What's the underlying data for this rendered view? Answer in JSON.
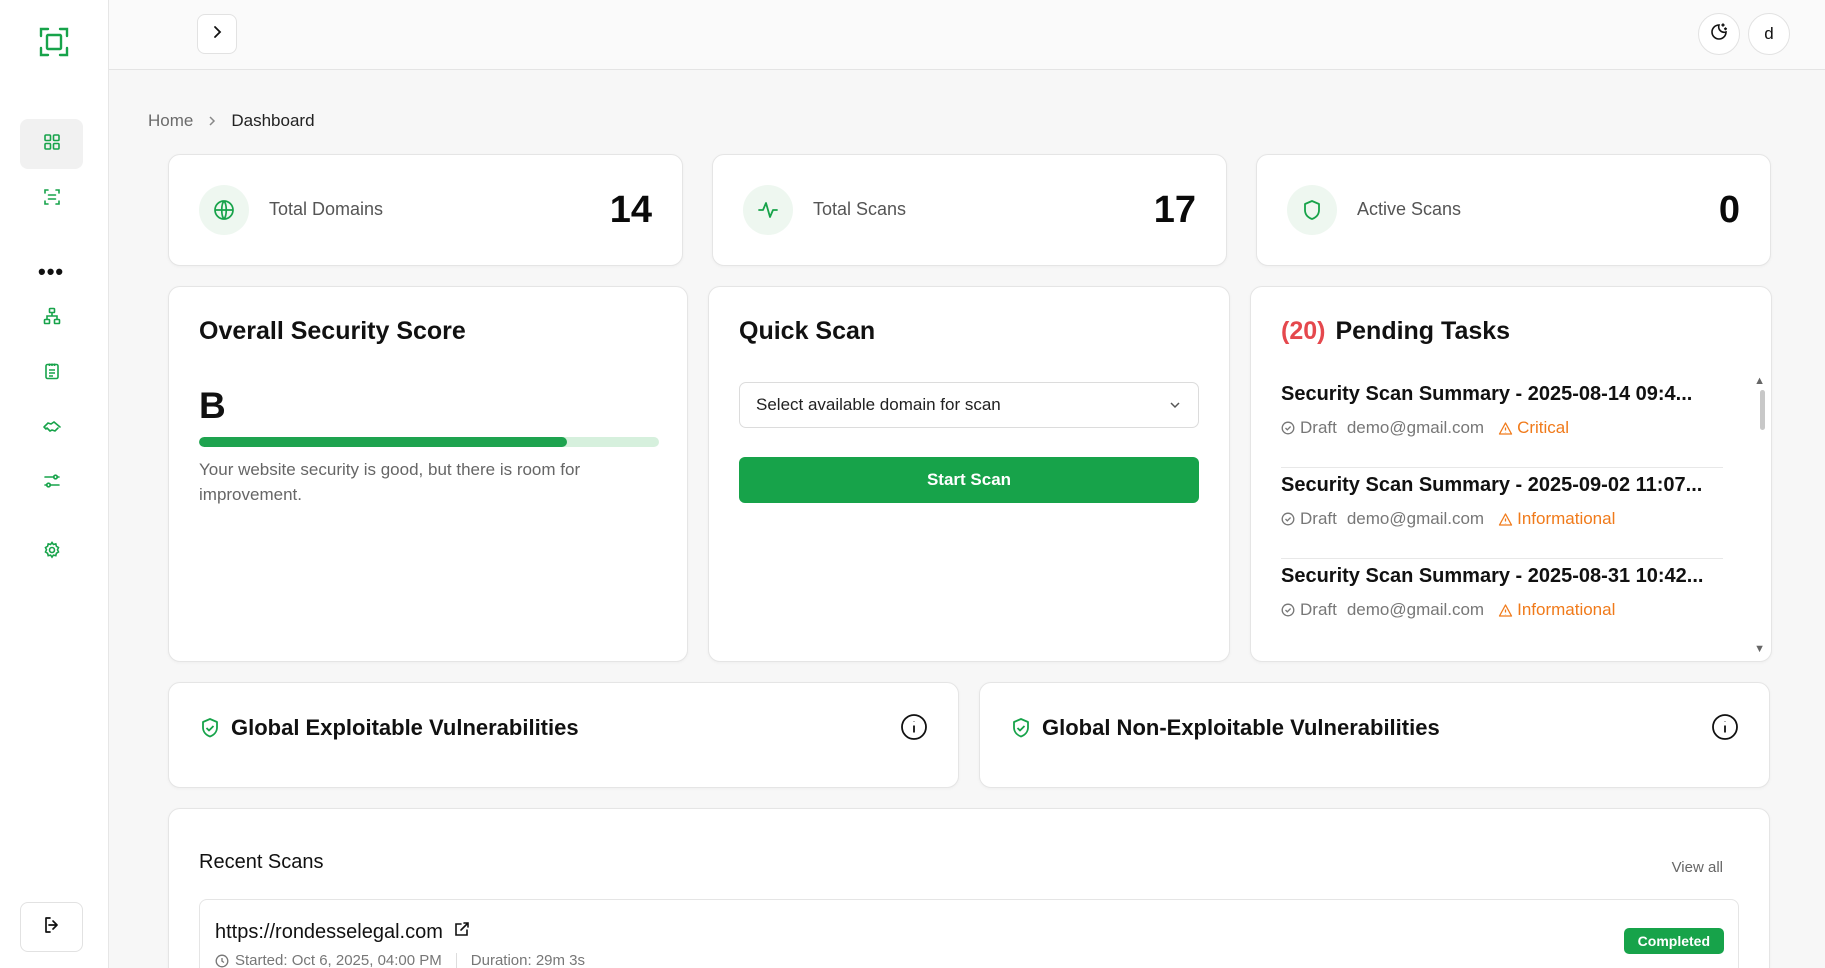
{
  "colors": {
    "accent": "#17a34a",
    "danger": "#e5484d",
    "warning": "#f07a1a"
  },
  "sidebar": {
    "items": [
      {
        "icon": "grid-icon",
        "active": true
      },
      {
        "icon": "scan-icon"
      },
      {
        "icon": "more-dots-icon"
      },
      {
        "icon": "network-icon"
      },
      {
        "icon": "clipboard-icon"
      },
      {
        "icon": "handshake-icon"
      },
      {
        "icon": "sliders-icon"
      },
      {
        "icon": "gear-icon"
      }
    ],
    "logout_icon": "logout-icon"
  },
  "topbar": {
    "theme_icon": "moon-icon",
    "avatar_letter": "d"
  },
  "breadcrumb": {
    "home": "Home",
    "current": "Dashboard"
  },
  "stats": [
    {
      "label": "Total Domains",
      "value": "14",
      "icon": "globe-icon"
    },
    {
      "label": "Total Scans",
      "value": "17",
      "icon": "activity-icon"
    },
    {
      "label": "Active Scans",
      "value": "0",
      "icon": "shield-icon"
    }
  ],
  "security": {
    "title": "Overall Security Score",
    "grade": "B",
    "progress_pct": 80,
    "description": "Your website security is good, but there is room for improvement."
  },
  "quick_scan": {
    "title": "Quick Scan",
    "select_value": "Select available domain for scan",
    "button": "Start Scan"
  },
  "pending": {
    "count": "(20)",
    "title": "Pending Tasks",
    "tasks": [
      {
        "title": "Security Scan Summary - 2025-08-14 09:4...",
        "status": "Draft",
        "email": "demo@gmail.com",
        "severity": "Critical"
      },
      {
        "title": "Security Scan Summary - 2025-09-02 11:07...",
        "status": "Draft",
        "email": "demo@gmail.com",
        "severity": "Informational"
      },
      {
        "title": "Security Scan Summary - 2025-08-31 10:42...",
        "status": "Draft",
        "email": "demo@gmail.com",
        "severity": "Informational"
      }
    ]
  },
  "vulnerabilities": {
    "exploitable": "Global Exploitable Vulnerabilities",
    "non_exploitable": "Global Non-Exploitable Vulnerabilities"
  },
  "recent": {
    "title": "Recent Scans",
    "view_all": "View all",
    "scans": [
      {
        "url": "https://rondesselegal.com",
        "started": "Started: Oct 6, 2025, 04:00 PM",
        "duration": "Duration: 29m 3s",
        "status": "Completed"
      }
    ]
  }
}
